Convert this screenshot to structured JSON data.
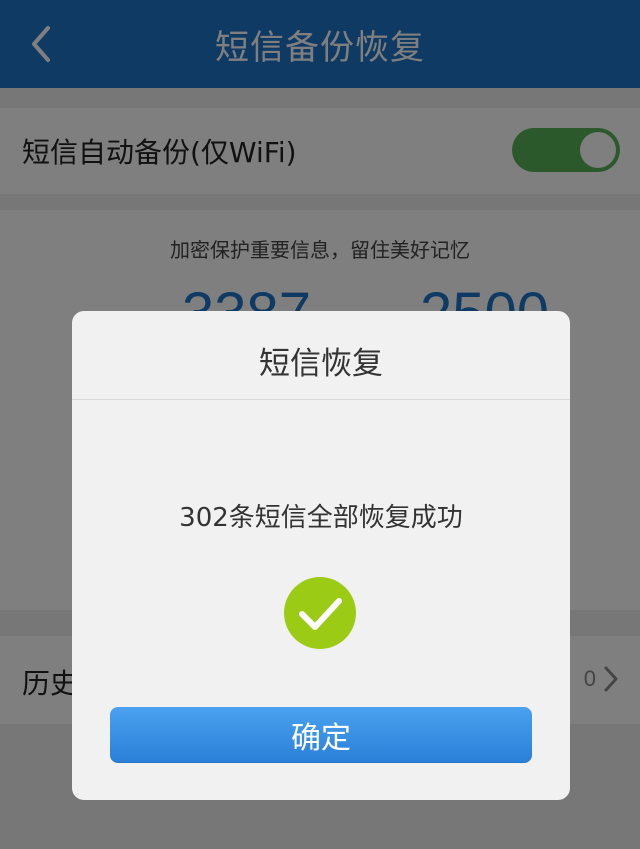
{
  "header": {
    "title": "短信备份恢复",
    "back_icon": "chevron-left-icon"
  },
  "auto_backup": {
    "label": "短信自动备份(仅WiFi)",
    "enabled": true
  },
  "info": {
    "slogan": "加密保护重要信息，留住美好记忆",
    "left_stat": "3387",
    "right_stat": "2500"
  },
  "history": {
    "label": "历史",
    "value": "0"
  },
  "dialog": {
    "title": "短信恢复",
    "message": "302条短信全部恢复成功",
    "confirm_label": "确定"
  },
  "colors": {
    "header": "#1d74c9",
    "toggle": "#58b358",
    "success": "#9ccb16",
    "button": "#2a7fd7"
  }
}
